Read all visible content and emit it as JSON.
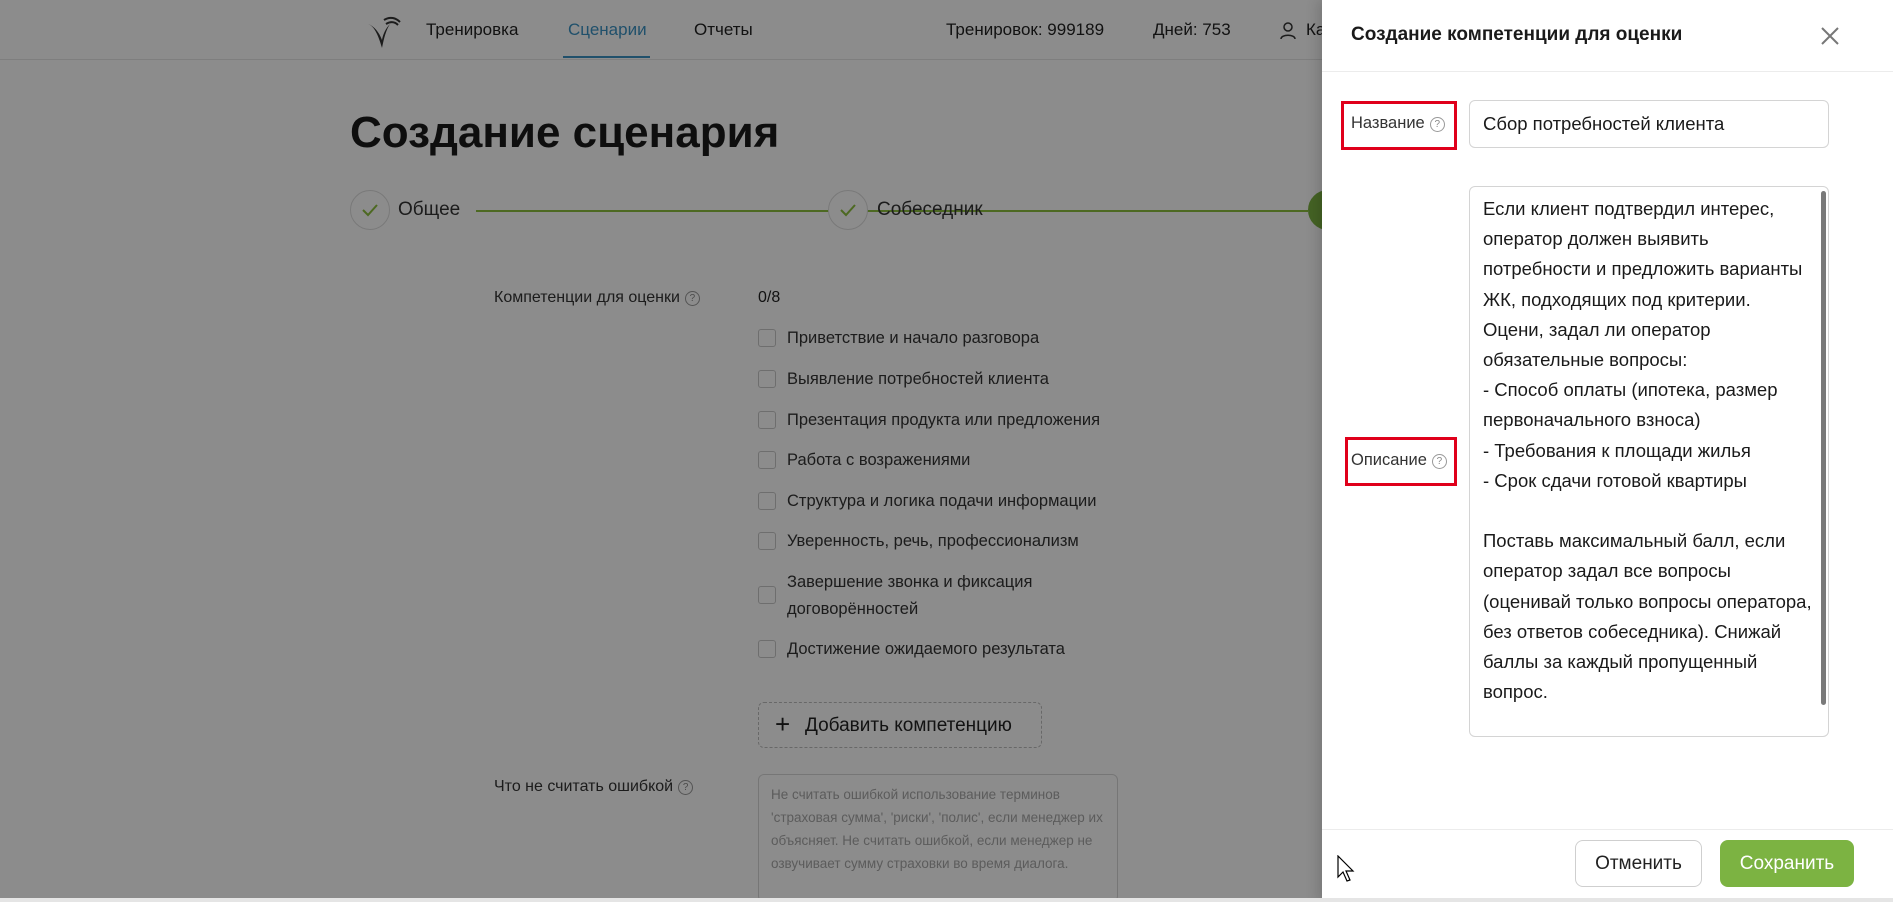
{
  "header": {
    "nav": [
      {
        "label": "Тренировка",
        "active": false
      },
      {
        "label": "Сценарии",
        "active": true
      },
      {
        "label": "Отчеты",
        "active": false
      }
    ],
    "trainings_stat": "Тренировок: 999189",
    "days_stat": "Дней: 753",
    "user_label_partial": "Ка"
  },
  "page": {
    "title": "Создание сценария",
    "steps": [
      {
        "label": "Общее",
        "state": "done"
      },
      {
        "label": "Собеседник",
        "state": "done"
      },
      {
        "label": "",
        "state": "active"
      }
    ],
    "competencies": {
      "label": "Компетенции для оценки",
      "counter": "0/8",
      "items": [
        "Приветствие и начало разговора",
        "Выявление потребностей клиента",
        "Презентация продукта или предложения",
        "Работа с возражениями",
        "Структура и логика подачи информации",
        "Уверенность, речь, профессионализм",
        "Завершение звонка и фиксация договорённостей",
        "Достижение ожидаемого результата"
      ],
      "add_button": "Добавить компетенцию"
    },
    "not_error": {
      "label": "Что не считать ошибкой",
      "placeholder": "Не считать ошибкой использование терминов 'страховая сумма', 'риски', 'полис', если менеджер их объясняет. Не считать ошибкой, если менеджер не озвучивает сумму страховки во время диалога."
    }
  },
  "drawer": {
    "title": "Создание компетенции для оценки",
    "name_label": "Название",
    "name_value": "Сбор потребностей клиента",
    "description_label": "Описание",
    "description_value": "Если клиент подтвердил интерес, оператор должен выявить потребности и предложить варианты ЖК, подходящих под критерии.\nОцени, задал ли оператор обязательные вопросы:\n- Способ оплаты (ипотека, размер первоначального взноса)\n- Требования к площади жилья\n- Срок сдачи готовой квартиры\n\nПоставь максимальный балл, если оператор задал все вопросы (оценивай только вопросы оператора, без ответов собеседника). Снижай баллы за каждый пропущенный вопрос.",
    "cancel_label": "Отменить",
    "save_label": "Сохранить"
  },
  "colors": {
    "accent_blue": "#3b93c4",
    "accent_green": "#7cb342",
    "highlight_red": "#e0001b"
  },
  "icons": [
    "logo-bird-icon",
    "user-icon",
    "check-icon",
    "help-icon",
    "plus-icon",
    "close-icon",
    "mouse-cursor-icon"
  ]
}
